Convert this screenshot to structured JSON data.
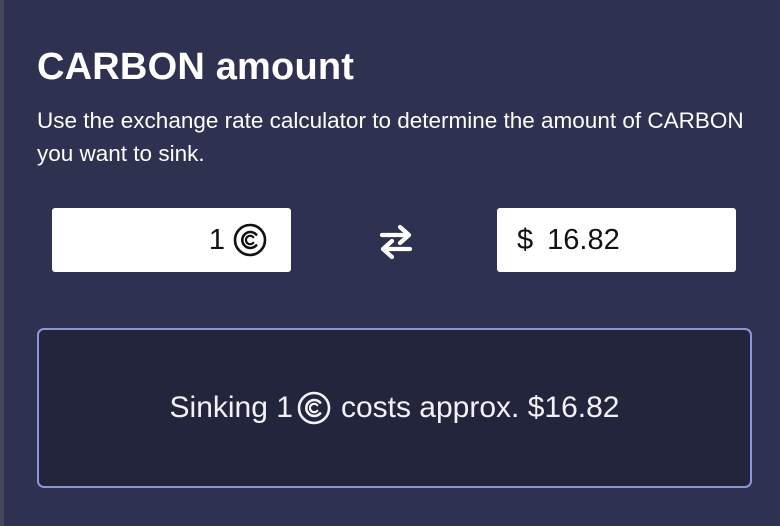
{
  "header": {
    "title": "CARBON amount",
    "description": "Use the exchange rate calculator to determine the amount of CARBON you want to sink."
  },
  "calculator": {
    "carbon_value": "1",
    "carbon_icon": "carbon-token-icon",
    "swap_icon": "swap-arrows-icon",
    "currency_symbol": "$",
    "usd_value": "16.82"
  },
  "summary": {
    "prefix": "Sinking 1",
    "suffix": "costs approx.",
    "price": "$16.82"
  },
  "colors": {
    "background": "#2f3150",
    "summary_background": "#23253d",
    "summary_border": "#8b98d8",
    "field_background": "#ffffff"
  }
}
